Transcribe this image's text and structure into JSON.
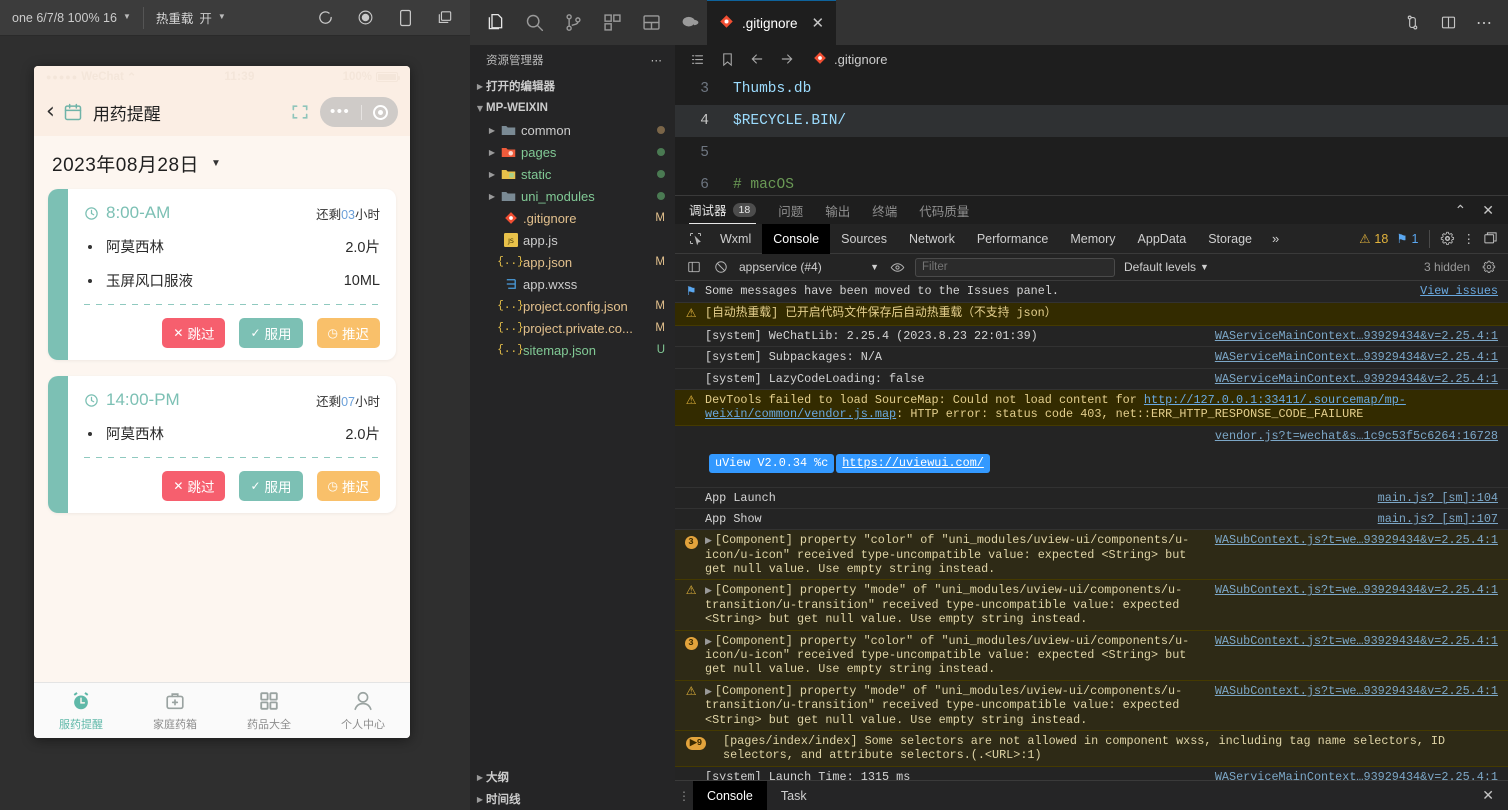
{
  "simulator": {
    "toolbar": {
      "device": "one 6/7/8 100% 16",
      "hot_reload_label": "热重载",
      "hot_reload_value": "开",
      "icons": [
        "refresh-icon",
        "record-icon",
        "device-icon",
        "window-icon"
      ]
    },
    "status_bar": {
      "carrier": "WeChat",
      "time": "11:39",
      "battery": "100%"
    },
    "nav": {
      "title": "用药提醒",
      "back_icon": "chevron-left-icon",
      "calendar_icon": "calendar-icon",
      "scan_icon": "scan-icon"
    },
    "date": "2023年08月28日",
    "cards": [
      {
        "time": "8:00-AM",
        "remaining_prefix": "还剩",
        "remaining_num": "03",
        "remaining_suffix": "小时",
        "meds": [
          {
            "name": "阿莫西林",
            "dose": "2.0片"
          },
          {
            "name": "玉屏风口服液",
            "dose": "10ML"
          }
        ],
        "buttons": [
          {
            "label": "跳过",
            "glyph": "✕",
            "kind": "skip"
          },
          {
            "label": "服用",
            "glyph": "✓",
            "kind": "take"
          },
          {
            "label": "推迟",
            "glyph": "◷",
            "kind": "delay"
          }
        ]
      },
      {
        "time": "14:00-PM",
        "remaining_prefix": "还剩",
        "remaining_num": "07",
        "remaining_suffix": "小时",
        "meds": [
          {
            "name": "阿莫西林",
            "dose": "2.0片"
          }
        ],
        "buttons": [
          {
            "label": "跳过",
            "glyph": "✕",
            "kind": "skip"
          },
          {
            "label": "服用",
            "glyph": "✓",
            "kind": "take"
          },
          {
            "label": "推迟",
            "glyph": "◷",
            "kind": "delay"
          }
        ]
      }
    ],
    "tabbar": [
      {
        "label": "服药提醒",
        "icon": "alarm-clock-icon",
        "active": true
      },
      {
        "label": "家庭药箱",
        "icon": "medkit-icon",
        "active": false
      },
      {
        "label": "药品大全",
        "icon": "grid-icon",
        "active": false
      },
      {
        "label": "个人中心",
        "icon": "user-icon",
        "active": false
      }
    ]
  },
  "vscode": {
    "activity_icons": [
      "files-icon",
      "search-icon",
      "source-control-icon",
      "extensions-icon",
      "split-layout-icon",
      "wechat-devtools-icon"
    ],
    "editor_tab": {
      "label": ".gitignore",
      "icon": "git-icon",
      "close": "✕"
    },
    "title_right_icons": [
      "source-control-sync-icon",
      "split-editor-icon",
      "more-actions-icon"
    ],
    "explorer": {
      "header": "资源管理器",
      "header_more": "⋯",
      "tree": [
        {
          "label": "打开的编辑器",
          "type": "section",
          "expanded": false,
          "indent": 0
        },
        {
          "label": "MP-WEIXIN",
          "type": "section",
          "expanded": true,
          "indent": 0
        },
        {
          "label": "common",
          "type": "folder",
          "icon": "folder-icon",
          "color": "plain",
          "dot": "brown",
          "indent": 1
        },
        {
          "label": "pages",
          "type": "folder",
          "icon": "folder-pages-icon",
          "color": "green",
          "dot": "green",
          "indent": 1
        },
        {
          "label": "static",
          "type": "folder",
          "icon": "folder-static-icon",
          "color": "green",
          "dot": "green",
          "indent": 1
        },
        {
          "label": "uni_modules",
          "type": "folder",
          "icon": "folder-icon",
          "color": "green",
          "dot": "green",
          "indent": 1
        },
        {
          "label": ".gitignore",
          "type": "file",
          "icon": "git-icon",
          "color": "yellow",
          "badge": "M",
          "indent": 1
        },
        {
          "label": "app.js",
          "type": "file",
          "icon": "js-icon",
          "color": "plain",
          "badge": "",
          "indent": 1
        },
        {
          "label": "app.json",
          "type": "file",
          "icon": "json-icon",
          "color": "yellow",
          "badge": "M",
          "indent": 1
        },
        {
          "label": "app.wxss",
          "type": "file",
          "icon": "css-icon",
          "color": "plain",
          "badge": "",
          "indent": 1
        },
        {
          "label": "project.config.json",
          "type": "file",
          "icon": "json-icon",
          "color": "yellow",
          "badge": "M",
          "indent": 1
        },
        {
          "label": "project.private.co...",
          "type": "file",
          "icon": "json-icon",
          "color": "yellow",
          "badge": "M",
          "indent": 1
        },
        {
          "label": "sitemap.json",
          "type": "file",
          "icon": "json-icon",
          "color": "green",
          "badge": "U",
          "indent": 1
        }
      ],
      "bottom_sections": [
        "大纲",
        "时间线"
      ]
    },
    "breadcrumb": {
      "icons": [
        "outline-icon",
        "bookmark-icon",
        "back-arrow-icon",
        "forward-arrow-icon"
      ],
      "file": ".gitignore",
      "file_icon": "git-icon"
    },
    "code": [
      {
        "num": "3",
        "text": "Thumbs.db",
        "highlight": false,
        "comment": false
      },
      {
        "num": "4",
        "text": "$RECYCLE.BIN/",
        "highlight": true,
        "comment": false
      },
      {
        "num": "5",
        "text": "",
        "highlight": false,
        "comment": false
      },
      {
        "num": "6",
        "text": "# macOS",
        "highlight": false,
        "comment": true
      }
    ],
    "panel_tabs": [
      {
        "label": "调试器",
        "count": "18",
        "active": true
      },
      {
        "label": "问题",
        "count": "",
        "active": false
      },
      {
        "label": "输出",
        "count": "",
        "active": false
      },
      {
        "label": "终端",
        "count": "",
        "active": false
      },
      {
        "label": "代码质量",
        "count": "",
        "active": false
      }
    ],
    "panel_right_icons": [
      "chevron-up-icon",
      "close-icon"
    ],
    "devtools": {
      "picker_icon": "inspect-element-icon",
      "tabs": [
        "Wxml",
        "Console",
        "Sources",
        "Network",
        "Performance",
        "Memory",
        "AppData",
        "Storage"
      ],
      "active_tab": "Console",
      "more": "»",
      "warning_count": "18",
      "info_count": "1",
      "right_icons": [
        "settings-gear-icon",
        "more-vertical-icon",
        "dock-icon"
      ],
      "filterbar": {
        "sidebar_icon": "console-sidebar-icon",
        "clear_icon": "clear-console-icon",
        "context": "appservice (#4)",
        "eye_icon": "live-expression-icon",
        "filter_placeholder": "Filter",
        "filter_value": "",
        "levels": "Default levels",
        "hidden_note": "3 hidden",
        "settings_icon": "settings-gear-icon"
      },
      "logs": [
        {
          "kind": "plain",
          "icon": "info-flag-icon",
          "message": "Some messages have been moved to the Issues panel.",
          "source": "View issues",
          "source_style": "blue"
        },
        {
          "kind": "warn",
          "icon": "warning-icon",
          "message": "[自动热重载] 已开启代码文件保存后自动热重载（不支持 json）",
          "source": ""
        },
        {
          "kind": "plain",
          "icon": "",
          "message": "[system] WeChatLib: 2.25.4 (2023.8.23 22:01:39)",
          "source": "WAServiceMainContext…93929434&v=2.25.4:1"
        },
        {
          "kind": "plain",
          "icon": "",
          "message": "[system] Subpackages: N/A",
          "source": "WAServiceMainContext…93929434&v=2.25.4:1"
        },
        {
          "kind": "plain",
          "icon": "",
          "message": "[system] LazyCodeLoading: false",
          "source": "WAServiceMainContext…93929434&v=2.25.4:1"
        },
        {
          "kind": "warn",
          "icon": "warning-icon",
          "message_pre": "DevTools failed to load SourceMap: Could not load content for ",
          "link": "http://127.0.0.1:33411/.sourcemap/mp-weixin/common/vendor.js.map",
          "message_post": ": HTTP error: status code 403, net::ERR_HTTP_RESPONSE_CODE_FAILURE",
          "source": ""
        },
        {
          "kind": "vendor-src",
          "source": "vendor.js?t=wechat&s…1c9c53f5c6264:16728"
        },
        {
          "kind": "uview",
          "chip": "uView V2.0.34 %c",
          "link": "https://uviewui.com/"
        },
        {
          "kind": "plain",
          "icon": "",
          "message": "App Launch",
          "source": "main.js? [sm]:104"
        },
        {
          "kind": "plain",
          "icon": "",
          "message": "App Show",
          "source": "main.js? [sm]:107"
        },
        {
          "kind": "warn-dark",
          "icon": "badge-3",
          "expandable": true,
          "message": "[Component] property \"color\" of \"uni_modules/uview-ui/components/u-icon/u-icon\" received type-uncompatible value: expected <String> but get null value. Use empty string instead.",
          "source": "WASubContext.js?t=we…93929434&v=2.25.4:1"
        },
        {
          "kind": "warn-dark",
          "icon": "warning-icon",
          "expandable": true,
          "message": "[Component] property \"mode\" of \"uni_modules/uview-ui/components/u-transition/u-transition\" received type-uncompatible value: expected <String> but get null value. Use empty string instead.",
          "source": "WASubContext.js?t=we…93929434&v=2.25.4:1"
        },
        {
          "kind": "warn-dark",
          "icon": "badge-3",
          "expandable": true,
          "message": "[Component] property \"color\" of \"uni_modules/uview-ui/components/u-icon/u-icon\" received type-uncompatible value: expected <String> but get null value. Use empty string instead.",
          "source": "WASubContext.js?t=we…93929434&v=2.25.4:1"
        },
        {
          "kind": "warn-dark",
          "icon": "warning-icon",
          "expandable": true,
          "message": "[Component] property \"mode\" of \"uni_modules/uview-ui/components/u-transition/u-transition\" received type-uncompatible value: expected <String> but get null value. Use empty string instead.",
          "source": "WASubContext.js?t=we…93929434&v=2.25.4:1"
        },
        {
          "kind": "warn-dark",
          "icon": "badge-9",
          "message": "[pages/index/index] Some selectors are not allowed in component wxss, including tag name selectors, ID selectors, and attribute selectors.(.<URL>:1)",
          "source": ""
        },
        {
          "kind": "plain",
          "icon": "",
          "message": "[system] Launch Time: 1315 ms",
          "source": "WAServiceMainContext…93929434&v=2.25.4:1"
        },
        {
          "kind": "prompt",
          "icon": "",
          "message": "",
          "source": ""
        }
      ]
    },
    "status_strip": {
      "handle": "⋮",
      "tabs": [
        {
          "label": "Console",
          "active": true
        },
        {
          "label": "Task",
          "active": false
        }
      ],
      "close": "✕"
    }
  },
  "colors": {
    "teal": "#7cc0b4",
    "skip_red": "#f65f6e",
    "delay_orange": "#f9c06a",
    "phone_bg": "#fdf6f0",
    "vscode_bg": "#1e1e1e",
    "console_warn_bg": "#332b00"
  }
}
